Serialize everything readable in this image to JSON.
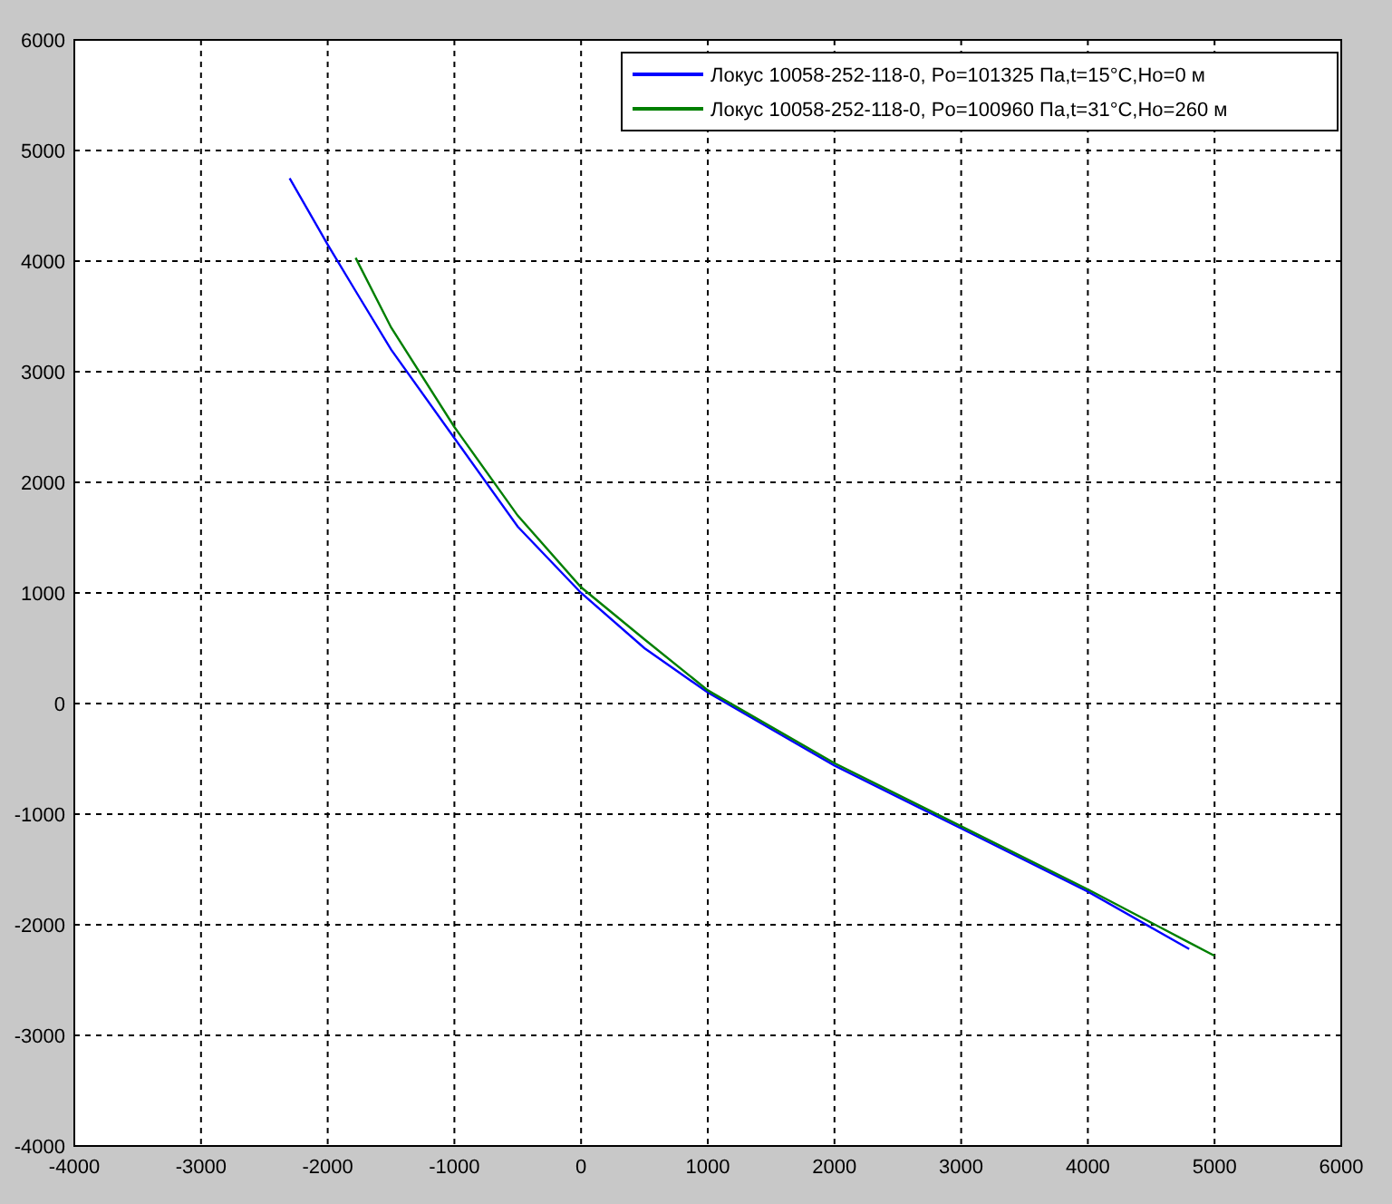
{
  "chart_data": {
    "type": "line",
    "x": [
      -2300,
      -2000,
      -1780,
      -1500,
      -1000,
      -500,
      0,
      500,
      1000,
      2000,
      3000,
      4000,
      4800,
      5000
    ],
    "series": [
      {
        "name": "Локус 10058-252-118-0, Po=101325 Па,t=15°C,Ho=0 м",
        "color": "#0000ff",
        "values": [
          4750,
          4150,
          3730,
          3200,
          2400,
          1600,
          1000,
          500,
          100,
          -560,
          -1130,
          -1700,
          -2220,
          null
        ]
      },
      {
        "name": "Локус 10058-252-118-0, Po=100960 Па,t=31°C,Ho=260 м",
        "color": "#007f00",
        "values": [
          null,
          null,
          4030,
          3400,
          2500,
          1700,
          1050,
          580,
          120,
          -540,
          -1110,
          -1680,
          -2160,
          -2280
        ]
      }
    ],
    "grid": true,
    "legend": true,
    "xlim": [
      -4000,
      6000
    ],
    "ylim": [
      -4000,
      6000
    ],
    "xticks": [
      -4000,
      -3000,
      -2000,
      -1000,
      0,
      1000,
      2000,
      3000,
      4000,
      5000,
      6000
    ],
    "yticks": [
      -4000,
      -3000,
      -2000,
      -1000,
      0,
      1000,
      2000,
      3000,
      4000,
      5000,
      6000
    ]
  }
}
